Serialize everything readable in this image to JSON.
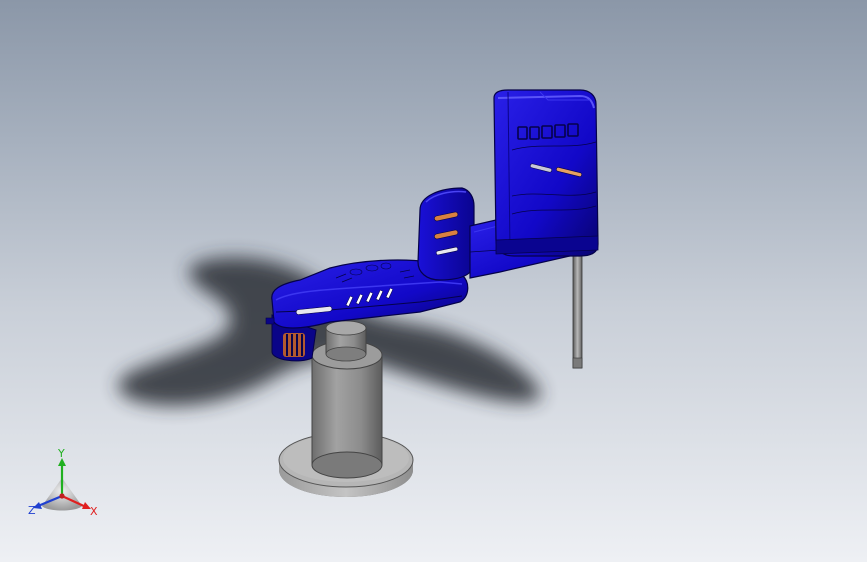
{
  "axes": {
    "x_label": "X",
    "y_label": "Y",
    "z_label": "Z"
  },
  "colors": {
    "background_top": "#8b97a8",
    "background_bottom": "#eef0f4",
    "arm_blue": "#1208c8",
    "arm_blue_dark": "#0a0480",
    "arm_blue_light": "#3a32ee",
    "column_gray": "#8a8a8a",
    "base_plate_gray": "#b4b4b4",
    "x_axis": "#e02020",
    "y_axis": "#20b020",
    "z_axis": "#2040d0"
  }
}
